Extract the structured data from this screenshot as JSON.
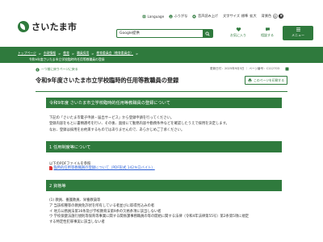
{
  "header": {
    "utility": {
      "language": "Language",
      "furigana": "ふりがな",
      "read_aloud": "音声読み上げ",
      "text_size_label": "文字サイズ",
      "size_standard": "標準",
      "size_large": "拡大",
      "bg_color_label": "背景色",
      "bg_white": "白",
      "bg_black": "黒"
    },
    "logo_text": "さいたま市",
    "search": {
      "value": "Google提供"
    },
    "buttons": {
      "favorites": "お気に入り",
      "consult": "相談する",
      "menu": "メニュー"
    }
  },
  "breadcrumb": {
    "items": [
      "トップページ",
      "市政情報",
      "教育",
      "職員採用",
      "教育委員会（教育委員会）"
    ],
    "current": "令和9年度さいたま市立学校臨時的任用等教職員の登録"
  },
  "page": {
    "back_link": "一つ前に戻りページに戻る",
    "page_id": "更新日付：2025年9月5日 ｜ ページ番号：C112703",
    "title": "令和9年度さいたま市立学校臨時的任用等教職員の登録",
    "readme_label": "このページを印刷する"
  },
  "sections": [
    {
      "heading": "令和9年度 さいたま市立学校臨時的任用等教職員の登録について",
      "lines": [
        "下記の「さいたま市電子申請・届出サービス」から登録申請を行ってください。",
        "登録内容をもとに書類選考を行い、その後、面接にて勤務内容や勤務条件などを確認したうえで採用を決定します。",
        "なお、登録は採用をお約束するものではありませんので、あらかじめご了承ください。"
      ]
    },
    {
      "heading": "1 任用制度等について",
      "lines": [
        "以下のPDFファイルを参照"
      ],
      "link": "臨時的任用等教職員の登録について（PDF形式 142キロバイト）"
    },
    {
      "heading": "2 資格等",
      "lines": [
        "(1) 教員、養護教員、栄養教諭等",
        "ア 当該校種等の教員免許状を所有している者並びに取得見込みの者",
        "イ 地方公務員法第16条及び学校教育法第9条の欠格条項に該当しない者",
        "ウ 学校保健法施行規則等保育等事業に関する関係課事務職員の等の開始に関する法律（令和4年法律第55号）第2条第5項に規定",
        "する特定性犯罪事実に該当しない者"
      ]
    }
  ]
}
